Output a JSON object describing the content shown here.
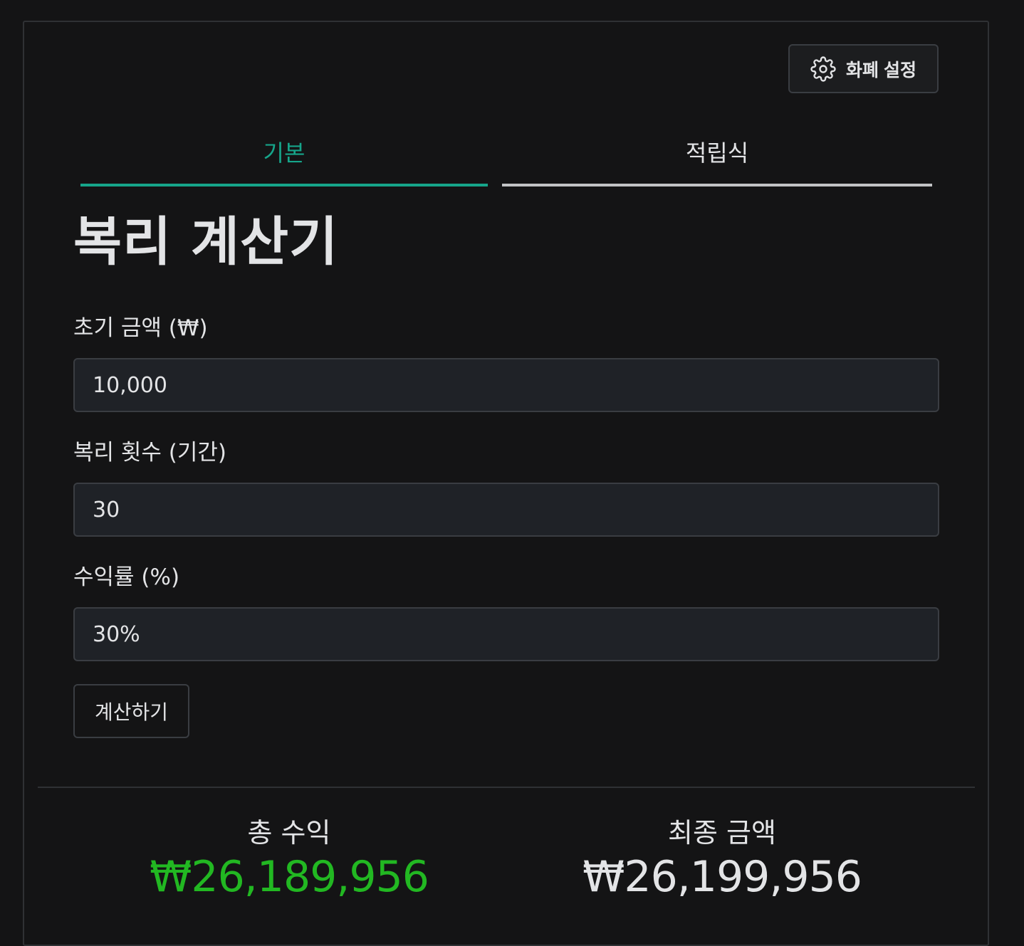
{
  "header": {
    "currency_settings_label": "화폐 설정",
    "currency_settings_icon": "gear-icon"
  },
  "tabs": [
    {
      "label": "기본",
      "active": true
    },
    {
      "label": "적립식",
      "active": false
    }
  ],
  "page_title": "복리 계산기",
  "form": {
    "initial_amount": {
      "label": "초기 금액 (₩)",
      "value": "10,000"
    },
    "compound_count": {
      "label": "복리 횟수 (기간)",
      "value": "30"
    },
    "rate": {
      "label": "수익률 (%)",
      "value": "30%"
    },
    "calculate_label": "계산하기"
  },
  "results": {
    "total_profit": {
      "label": "총 수익",
      "value": "₩26,189,956"
    },
    "final_amount": {
      "label": "최종 금액",
      "value": "₩26,199,956"
    }
  },
  "colors": {
    "accent": "#16a58a",
    "profit": "#22b822",
    "background": "#141415",
    "input_background": "#1f2227"
  }
}
